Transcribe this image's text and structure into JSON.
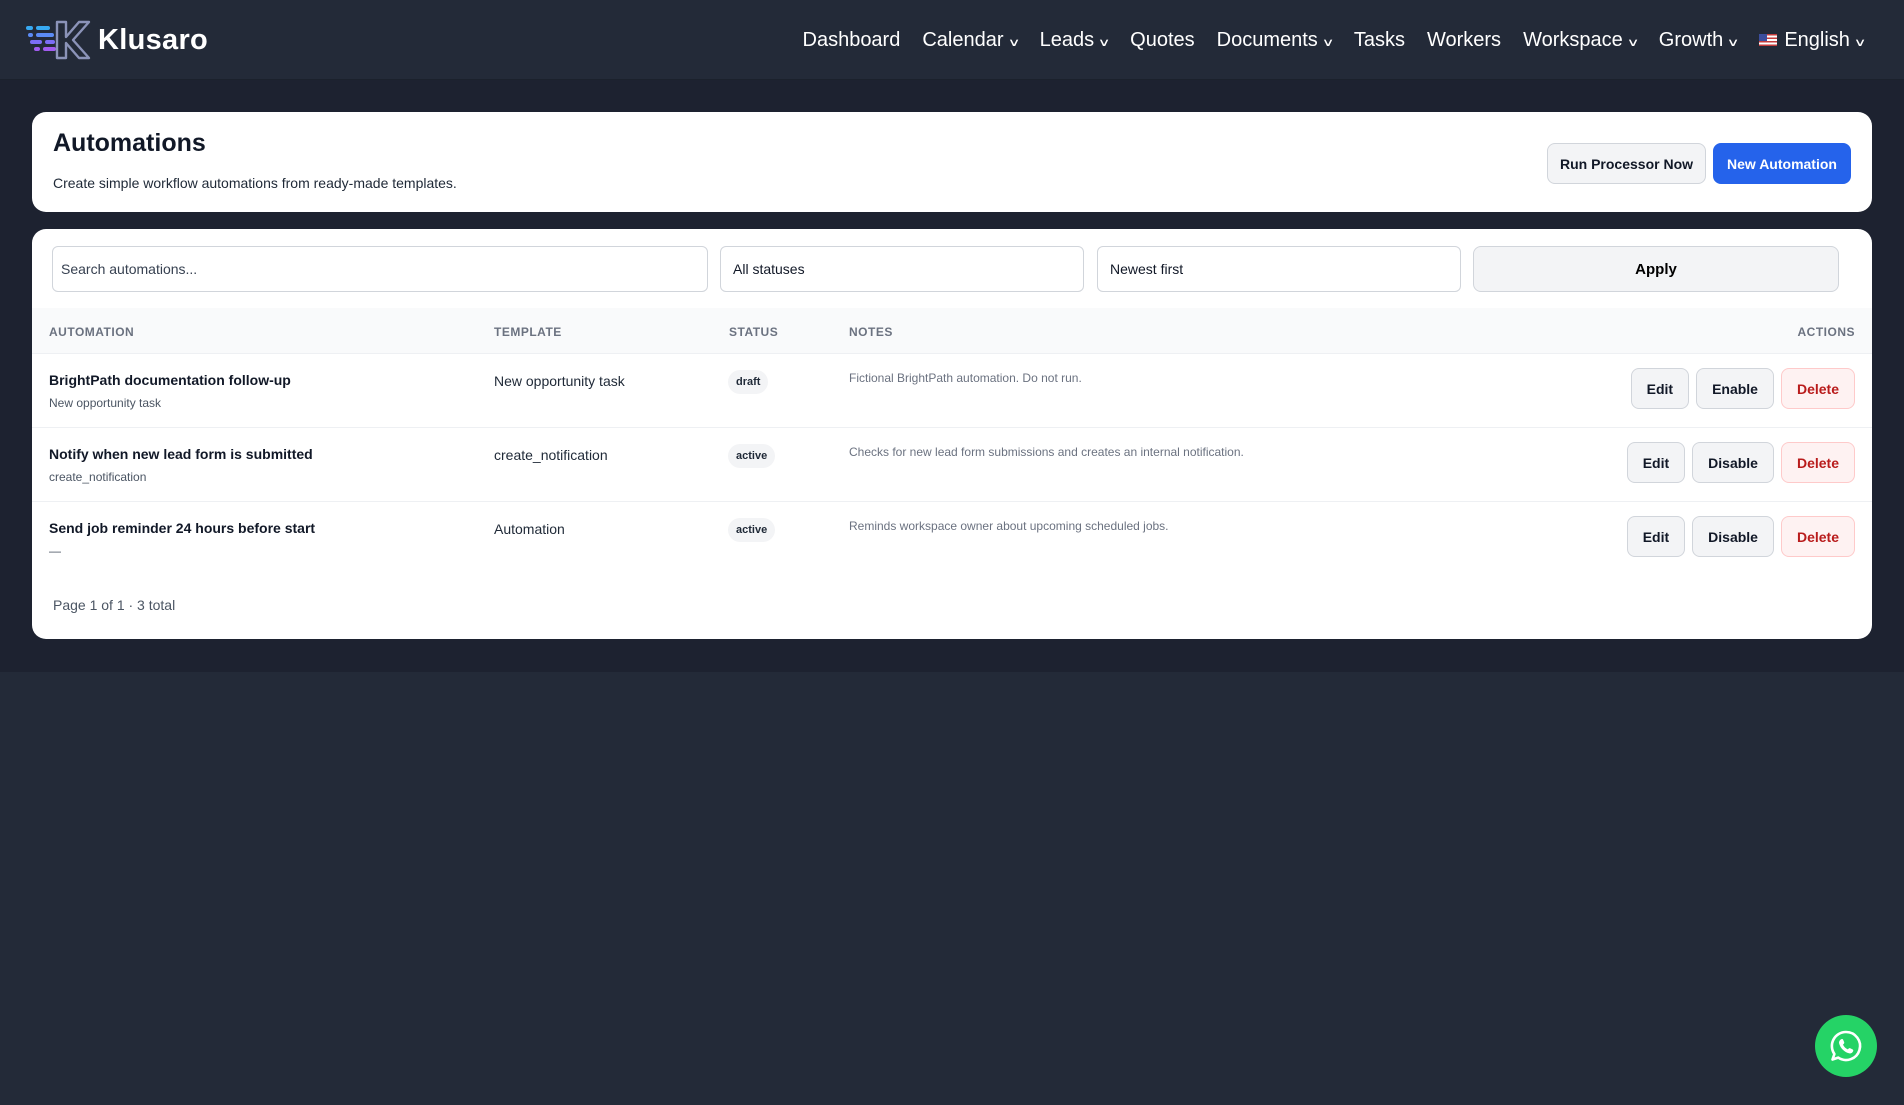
{
  "brand": {
    "name": "Klusaro"
  },
  "nav": {
    "items": [
      {
        "label": "Dashboard",
        "dropdown": false
      },
      {
        "label": "Calendar",
        "dropdown": true
      },
      {
        "label": "Leads",
        "dropdown": true
      },
      {
        "label": "Quotes",
        "dropdown": false
      },
      {
        "label": "Documents",
        "dropdown": true
      },
      {
        "label": "Tasks",
        "dropdown": false
      },
      {
        "label": "Workers",
        "dropdown": false
      },
      {
        "label": "Workspace",
        "dropdown": true
      },
      {
        "label": "Growth",
        "dropdown": true
      }
    ],
    "language": "English"
  },
  "header": {
    "title": "Automations",
    "subtitle": "Create simple workflow automations from ready-made templates.",
    "run_label": "Run Processor Now",
    "new_label": "New Automation"
  },
  "filters": {
    "search_placeholder": "Search automations...",
    "status_value": "All statuses",
    "sort_value": "Newest first",
    "apply_label": "Apply"
  },
  "table": {
    "columns": {
      "automation": "AUTOMATION",
      "template": "TEMPLATE",
      "status": "STATUS",
      "notes": "NOTES",
      "actions": "ACTIONS"
    },
    "rows": [
      {
        "name": "BrightPath documentation follow-up",
        "subtitle": "New opportunity task",
        "template": "New opportunity task",
        "status": "draft",
        "notes": "Fictional BrightPath automation. Do not run.",
        "edit": "Edit",
        "toggle": "Enable",
        "delete": "Delete"
      },
      {
        "name": "Notify when new lead form is submitted",
        "subtitle": "create_notification",
        "template": "create_notification",
        "status": "active",
        "notes": "Checks for new lead form submissions and creates an internal notification.",
        "edit": "Edit",
        "toggle": "Disable",
        "delete": "Delete"
      },
      {
        "name": "Send job reminder 24 hours before start",
        "subtitle": "—",
        "template": "Automation",
        "status": "active",
        "notes": "Reminds workspace owner about upcoming scheduled jobs.",
        "edit": "Edit",
        "toggle": "Disable",
        "delete": "Delete"
      }
    ]
  },
  "pagination": {
    "text": "Page 1 of 1 · 3 total"
  },
  "colors": {
    "nav_bg": "#232a38",
    "page_bg": "#1d2230",
    "primary": "#2563eb",
    "danger": "#b91c1c",
    "whatsapp": "#25d366"
  },
  "icons": [
    "logo-icon",
    "chevron-down-icon",
    "us-flag-icon",
    "whatsapp-icon"
  ]
}
